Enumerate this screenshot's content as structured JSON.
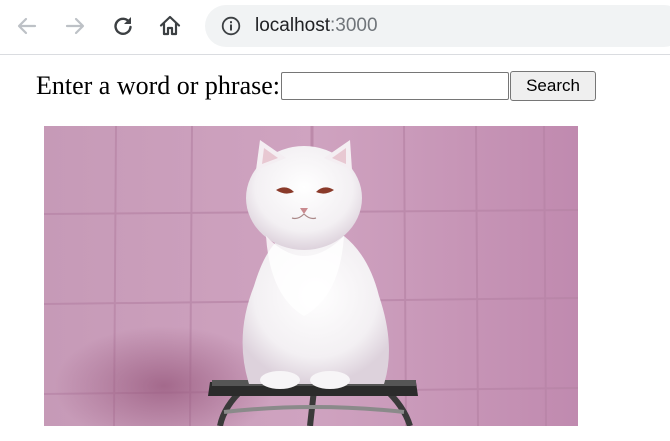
{
  "browser": {
    "url_host": "localhost",
    "url_port": ":3000",
    "icons": {
      "back": "arrow-left-icon",
      "forward": "arrow-right-icon",
      "reload": "reload-icon",
      "home": "home-icon",
      "site_info": "info-icon"
    }
  },
  "page": {
    "search_prompt": "Enter a word or phrase:",
    "search_input_value": "",
    "search_button_label": "Search",
    "image": {
      "subject": "white fluffy cat sitting on a stool",
      "background_color": "#c996b6"
    }
  }
}
